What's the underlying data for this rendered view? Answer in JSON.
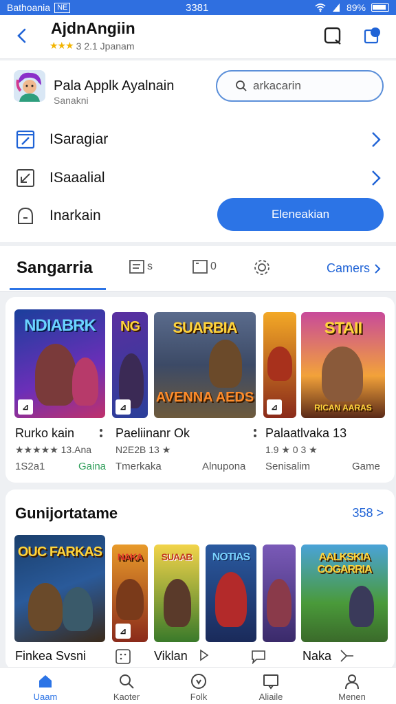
{
  "status": {
    "carrier": "Bathoania",
    "box": "NE",
    "time": "3381",
    "battery": "89%"
  },
  "header": {
    "title": "AjdnAngiin",
    "stars": "★★★",
    "rating_text": "3 2.1 Jpanam"
  },
  "profile": {
    "name": "Pala Applk Ayalnain",
    "subtitle": "Sanakni"
  },
  "search": {
    "placeholder": "arkacarin"
  },
  "menu": [
    {
      "label": "ISaragiar"
    },
    {
      "label": "ISaaalial"
    },
    {
      "label": "Inarkain"
    }
  ],
  "primary_button": "Eleneakian",
  "tabs": {
    "active": "Sangarria",
    "icon1_text": "s",
    "icon2_text": "0",
    "link": "Camers"
  },
  "section1": {
    "games": [
      {
        "tile_title": "NDIABRK",
        "title": "Rurko kain",
        "meta": "★★★★★ 13.Ana",
        "sub": "1S2a1",
        "cat": "Gaina"
      },
      {
        "tile_title": "NG",
        "title": "",
        "meta": "",
        "sub": "",
        "cat": ""
      },
      {
        "tile_title": "SUARBIA",
        "tile_sub": "AVENNA AEDS",
        "title": "Paeliinanr Ok",
        "meta": "N2E2B 13 ★",
        "sub": "Tmerkaka",
        "cat": "Alnupona"
      },
      {
        "tile_title": "",
        "title": "",
        "meta": "",
        "sub": "",
        "cat": ""
      },
      {
        "tile_title": "STAII",
        "tile_sub": "RICAN AARAS",
        "title": "Palaatlvaka 13",
        "meta": "1.9 ★ 0 3 ★",
        "sub": "Senisalim",
        "cat": "Game"
      }
    ]
  },
  "section2": {
    "title": "Gunijortatame",
    "link": "358 >",
    "games": [
      {
        "tile_title": "OUC FARKAS",
        "title": "Finkea Svsni"
      },
      {
        "tile_title": "NAKA",
        "title": ""
      },
      {
        "tile_title": "SUAAB",
        "title": "Viklan"
      },
      {
        "tile_title": "NOTIAS",
        "title": ""
      },
      {
        "tile_title": "",
        "title": ""
      },
      {
        "tile_title": "AALKSKIA COGARRIA",
        "title": "Naka"
      }
    ]
  },
  "nav": [
    {
      "label": "Uaam"
    },
    {
      "label": "Kaoter"
    },
    {
      "label": "Folk"
    },
    {
      "label": "Aliaile"
    },
    {
      "label": "Menen"
    }
  ],
  "colors": {
    "accent": "#2c74e6",
    "star": "#f2b400",
    "green_category": "#2f9e5a"
  }
}
